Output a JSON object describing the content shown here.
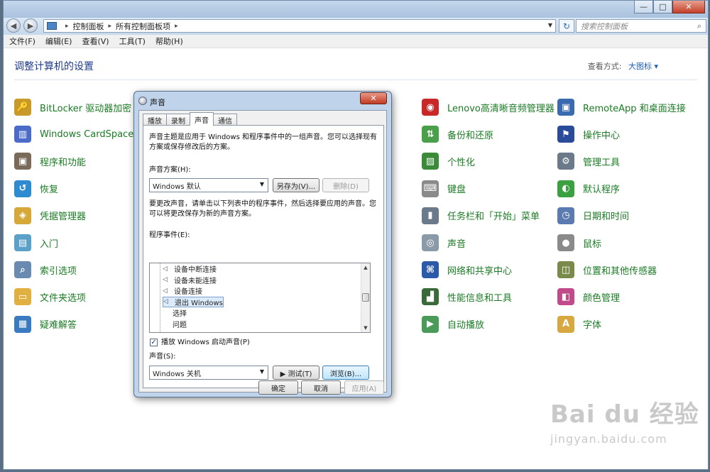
{
  "window": {
    "minimize": "—",
    "maximize": "□",
    "close": "✕",
    "back": "◀",
    "forward": "▶"
  },
  "address": {
    "crumbs": [
      "控制面板",
      "所有控制面板项"
    ],
    "refresh": "↻",
    "search_placeholder": "搜索控制面板"
  },
  "menu": [
    "文件(F)",
    "编辑(E)",
    "查看(V)",
    "工具(T)",
    "帮助(H)"
  ],
  "page": {
    "title": "调整计算机的设置",
    "viewby_label": "查看方式:",
    "viewby_value": "大图标 ▾"
  },
  "items_left": [
    {
      "label": "BitLocker 驱动器加密",
      "icon": "key-lock-icon",
      "color": "#c89a2a",
      "glyph": "🔑"
    },
    {
      "label": "Windows CardSpace",
      "icon": "cardspace-icon",
      "color": "#4a6cc8",
      "glyph": "▥"
    },
    {
      "label": "程序和功能",
      "icon": "programs-icon",
      "color": "#7a6a5a",
      "glyph": "▣"
    },
    {
      "label": "恢复",
      "icon": "recovery-icon",
      "color": "#2e8bd0",
      "glyph": "↺"
    },
    {
      "label": "凭据管理器",
      "icon": "credential-icon",
      "color": "#d6a83a",
      "glyph": "◈"
    },
    {
      "label": "入门",
      "icon": "getting-started-icon",
      "color": "#5aa0c8",
      "glyph": "▤"
    },
    {
      "label": "索引选项",
      "icon": "index-icon",
      "color": "#6a8ab0",
      "glyph": "⌕"
    },
    {
      "label": "文件夹选项",
      "icon": "folder-options-icon",
      "color": "#e0b040",
      "glyph": "▭"
    },
    {
      "label": "疑难解答",
      "icon": "troubleshoot-icon",
      "color": "#3a7ac0",
      "glyph": "▦"
    }
  ],
  "items_mid": [
    {
      "label": "Lenovo高清晰音频管理器",
      "icon": "audio-manager-icon",
      "color": "#c82828",
      "glyph": "◉"
    },
    {
      "label": "备份和还原",
      "icon": "backup-icon",
      "color": "#4aa04a",
      "glyph": "⇅"
    },
    {
      "label": "个性化",
      "icon": "personalize-icon",
      "color": "#3a8a3a",
      "glyph": "▨"
    },
    {
      "label": "键盘",
      "icon": "keyboard-icon",
      "color": "#8a8a8a",
      "glyph": "⌨"
    },
    {
      "label": "任务栏和「开始」菜单",
      "icon": "taskbar-icon",
      "color": "#6a7a8a",
      "glyph": "▮"
    },
    {
      "label": "声音",
      "icon": "sound-icon",
      "color": "#8a9aa8",
      "glyph": "◎"
    },
    {
      "label": "网络和共享中心",
      "icon": "network-icon",
      "color": "#2a5aa8",
      "glyph": "⌘"
    },
    {
      "label": "性能信息和工具",
      "icon": "performance-icon",
      "color": "#3a6a3a",
      "glyph": "▟"
    },
    {
      "label": "自动播放",
      "icon": "autoplay-icon",
      "color": "#4a9a5a",
      "glyph": "▶"
    }
  ],
  "items_right": [
    {
      "label": "RemoteApp 和桌面连接",
      "icon": "remoteapp-icon",
      "color": "#3a6ab0",
      "glyph": "▣"
    },
    {
      "label": "操作中心",
      "icon": "action-center-icon",
      "color": "#2a4a9a",
      "glyph": "⚑"
    },
    {
      "label": "管理工具",
      "icon": "admin-tools-icon",
      "color": "#6a7a8a",
      "glyph": "⚙"
    },
    {
      "label": "默认程序",
      "icon": "default-programs-icon",
      "color": "#3aa040",
      "glyph": "◐"
    },
    {
      "label": "日期和时间",
      "icon": "datetime-icon",
      "color": "#5a7ab0",
      "glyph": "◷"
    },
    {
      "label": "鼠标",
      "icon": "mouse-icon",
      "color": "#8a8a8a",
      "glyph": "●"
    },
    {
      "label": "位置和其他传感器",
      "icon": "sensor-icon",
      "color": "#7a8a4a",
      "glyph": "◫"
    },
    {
      "label": "颜色管理",
      "icon": "color-mgmt-icon",
      "color": "#c04a8a",
      "glyph": "◧"
    },
    {
      "label": "字体",
      "icon": "font-icon",
      "color": "#d8a840",
      "glyph": "A"
    }
  ],
  "dialog": {
    "title": "声音",
    "close": "✕",
    "tabs": [
      "播放",
      "录制",
      "声音",
      "通信"
    ],
    "desc": "声音主题是应用于 Windows 和程序事件中的一组声音。您可以选择现有方案或保存修改后的方案。",
    "scheme_label": "声音方案(H):",
    "scheme_value": "Windows 默认",
    "save_as": "另存为(V)...",
    "delete": "删除(D)",
    "change_desc": "要更改声音，请单击以下列表中的程序事件，然后选择要应用的声音。您可以将更改保存为新的声音方案。",
    "events_label": "程序事件(E):",
    "events": [
      {
        "label": "设备中断连接",
        "has_sound": true,
        "selected": false
      },
      {
        "label": "设备未能连接",
        "has_sound": true,
        "selected": false
      },
      {
        "label": "设备连接",
        "has_sound": true,
        "selected": false
      },
      {
        "label": "退出 Windows",
        "has_sound": true,
        "selected": true
      },
      {
        "label": "选择",
        "has_sound": false,
        "selected": false
      },
      {
        "label": "问题",
        "has_sound": false,
        "selected": false
      }
    ],
    "startup_check": "✓",
    "startup_label": "播放 Windows 启动声音(P)",
    "sound_label": "声音(S):",
    "sound_value": "Windows 关机",
    "test": "▶ 测试(T)",
    "browse": "浏览(B)...",
    "ok": "确定",
    "cancel": "取消",
    "apply": "应用(A)"
  },
  "watermark": {
    "brand": "Bai du 经验",
    "url": "jingyan.baidu.com"
  }
}
